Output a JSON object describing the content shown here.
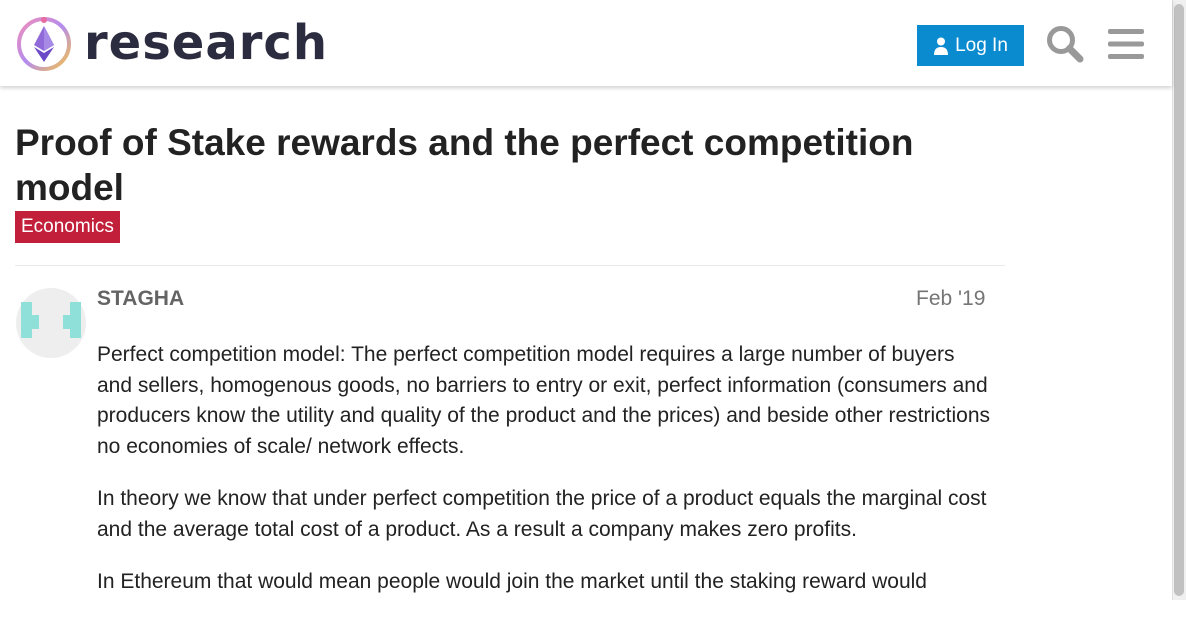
{
  "header": {
    "logo_text": "research",
    "login_label": "Log In",
    "icons": [
      "logo-icon",
      "user-icon",
      "search-icon",
      "hamburger-menu-icon"
    ],
    "accent_color": "#0a8bd0"
  },
  "topic": {
    "title": "Proof of Stake rewards and the perfect competition model",
    "category": "Economics",
    "category_color": "#c2203a"
  },
  "post": {
    "username": "STAGHA",
    "date": "Feb '19",
    "paragraphs": [
      "Perfect competition model: The perfect competition model requires a large number of buyers and sellers, homogenous goods, no barriers to entry or exit, perfect information (consumers and producers know the utility and quality of the product and the prices) and beside other restrictions no economies of scale/ network effects.",
      "In theory we know that under perfect competition the price of a product equals the marginal cost and the average total cost of a product. As a result a company makes zero profits.",
      "In Ethereum that would mean people would join the market until the staking reward would"
    ]
  }
}
